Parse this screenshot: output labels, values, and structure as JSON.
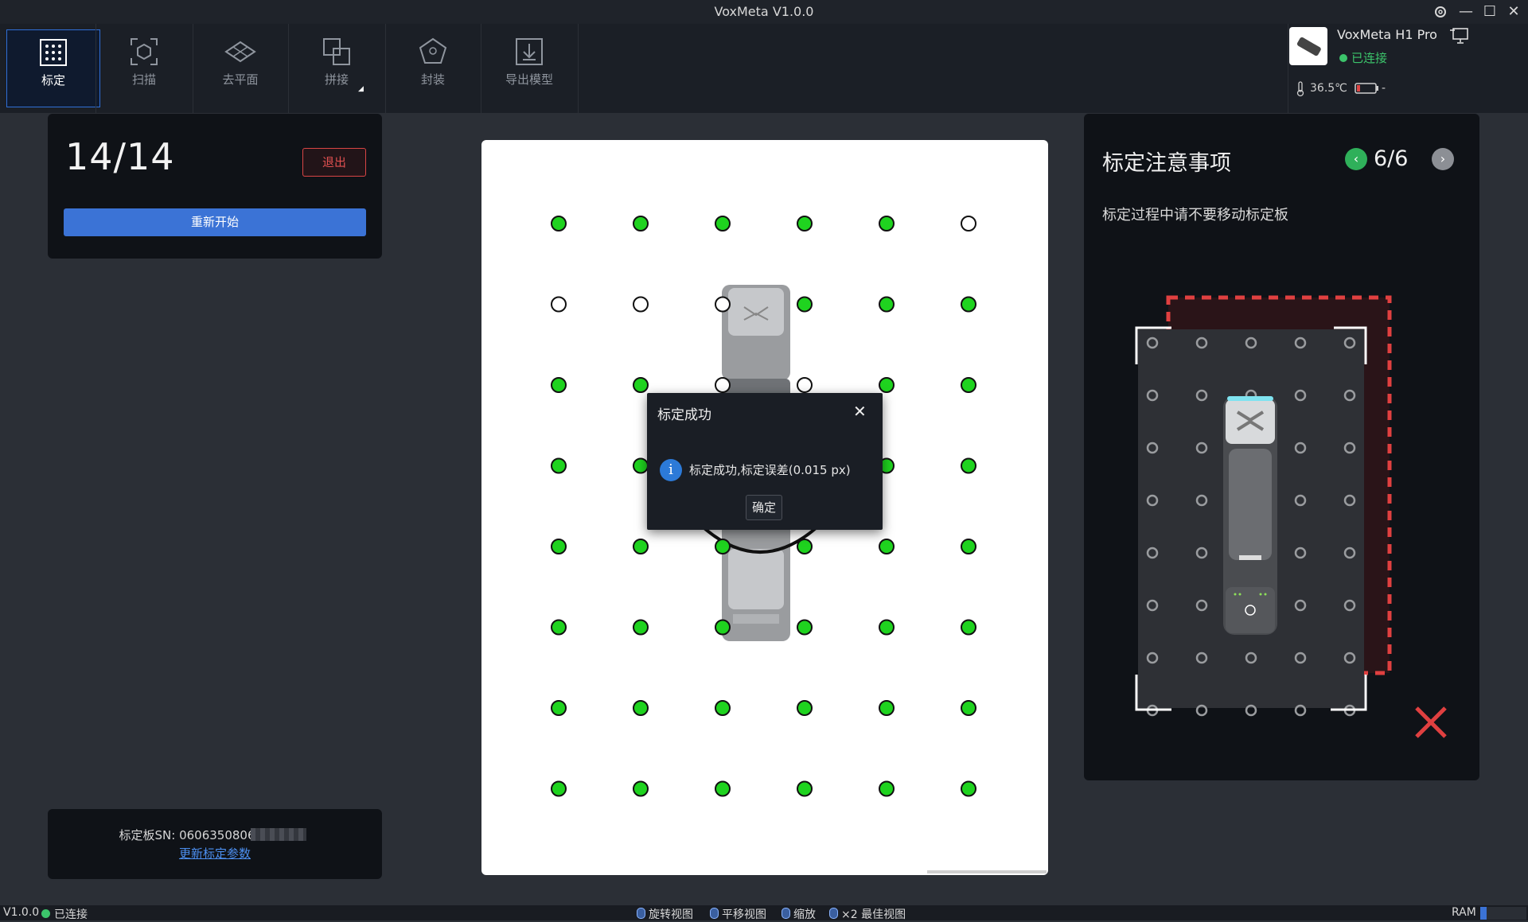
{
  "app": {
    "title": "VoxMeta V1.0.0"
  },
  "toolbar": {
    "items": [
      {
        "label": "标定",
        "active": true
      },
      {
        "label": "扫描",
        "active": false
      },
      {
        "label": "去平面",
        "active": false
      },
      {
        "label": "拼接",
        "active": false
      },
      {
        "label": "封装",
        "active": false
      },
      {
        "label": "导出模型",
        "active": false
      }
    ]
  },
  "device": {
    "name": "VoxMeta H1 Pro",
    "status": "已连接",
    "temperature": "36.5℃",
    "battery": "-"
  },
  "calibration": {
    "progress": "14/14",
    "exit_label": "退出",
    "restart_label": "重新开始",
    "board_sn": "标定板SN: 0606350806",
    "update_link": "更新标定参数"
  },
  "dialog": {
    "title": "标定成功",
    "message": "标定成功,标定误差(0.015 px)",
    "ok_label": "确定"
  },
  "notes": {
    "title": "标定注意事项",
    "page": "6/6",
    "text": "标定过程中请不要移动标定板"
  },
  "board": {
    "grid": [
      [
        1,
        1,
        1,
        1,
        1,
        0
      ],
      [
        0,
        0,
        0,
        1,
        1,
        1
      ],
      [
        1,
        1,
        0,
        0,
        1,
        1
      ],
      [
        1,
        1,
        1,
        1,
        1,
        1
      ],
      [
        1,
        1,
        1,
        1,
        1,
        1
      ],
      [
        1,
        1,
        1,
        1,
        1,
        1
      ],
      [
        1,
        1,
        1,
        1,
        1,
        1
      ],
      [
        1,
        1,
        1,
        1,
        1,
        1
      ]
    ],
    "detected_color": "#1fd31f"
  },
  "statusbar": {
    "version": "V1.0.0",
    "connection": "已连接",
    "hints": [
      "旋转视图",
      "平移视图",
      "缩放",
      "×2 最佳视图"
    ],
    "ram_label": "RAM"
  },
  "colors": {
    "accent": "#3b73d6",
    "danger": "#e05050",
    "success": "#3cc46b"
  }
}
